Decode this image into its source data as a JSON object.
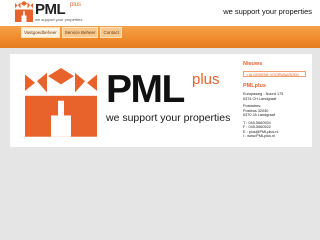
{
  "header": {
    "brand": "PML",
    "brand_plus": "plus",
    "logo_tagline": "we support your properties",
    "slogan": "we support your properties"
  },
  "nav": {
    "tabs": [
      {
        "label": "Vastgoedbeheer",
        "active": true
      },
      {
        "label": "Service Beheer",
        "active": false
      },
      {
        "label": "Contact",
        "active": false
      }
    ]
  },
  "main": {
    "brand": "PML",
    "brand_plus": "plus",
    "tagline": "we support your properties"
  },
  "sidebar": {
    "news_heading": "Nieuws",
    "news_link": "> ALGEMENE VOORWAARDEN",
    "company_heading": "PMLplus",
    "address_lines": [
      "Europaweg - Noord 175",
      "6374 CH Landgraaf"
    ],
    "postal_lines": [
      "Postadres:",
      "Postbus 32030",
      "6370 JA Landgraaf"
    ],
    "contact_lines": [
      "T : 045-5660524",
      "F : 045-5660522",
      "E : pius@PMLplus.nl",
      "I : www.PMLplus.nl"
    ]
  },
  "colors": {
    "accent": "#e8632b",
    "nav": "#ee8a2a",
    "background": "#e5e5e5"
  }
}
